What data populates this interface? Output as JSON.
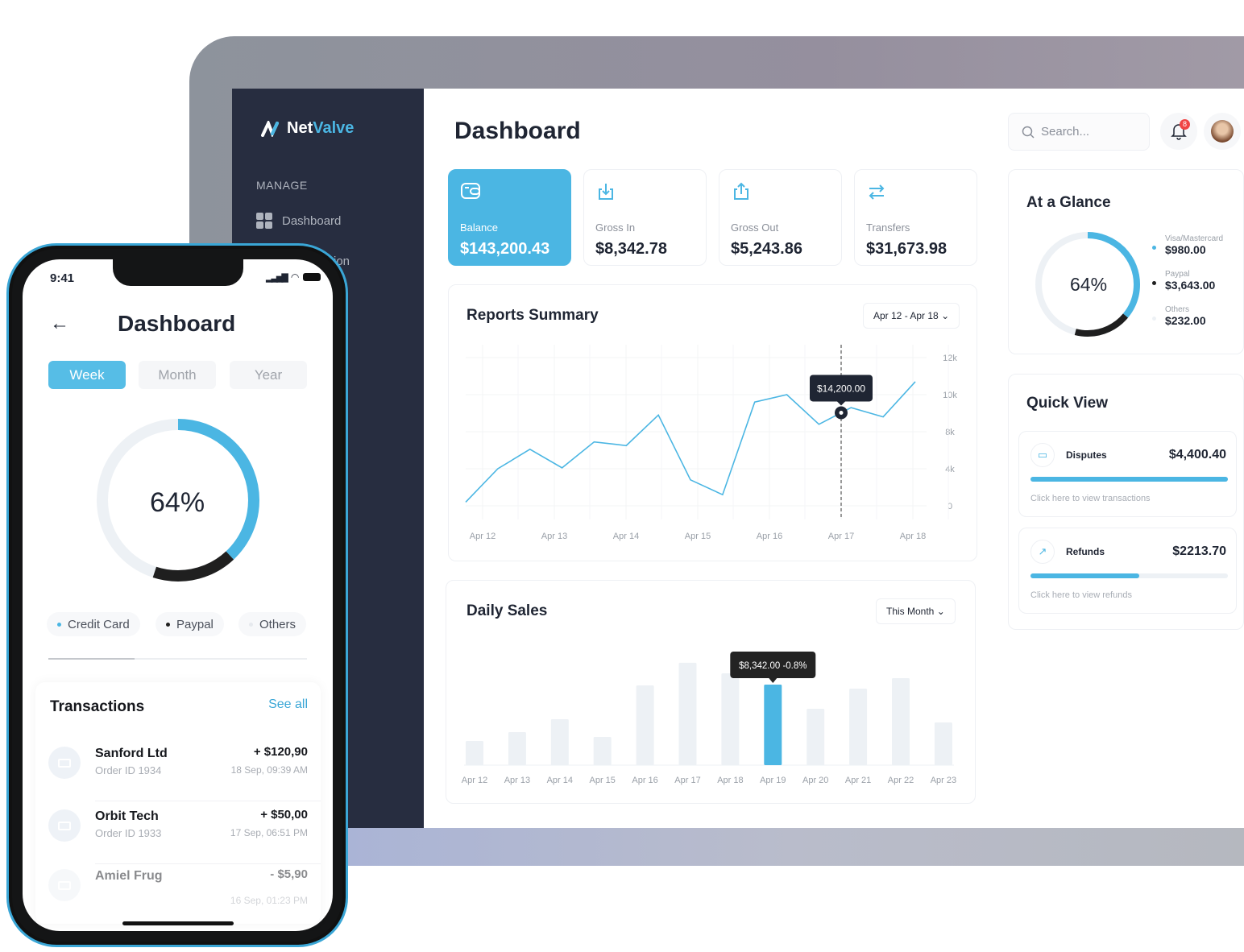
{
  "brand": {
    "name_part1": "Net",
    "name_part2": "Valve"
  },
  "sidebar": {
    "section": "MANAGE",
    "items": [
      {
        "label": "Dashboard",
        "icon": "grid-icon"
      },
      {
        "label": "ion"
      }
    ]
  },
  "header": {
    "title": "Dashboard",
    "search_placeholder": "Search...",
    "notification_count": "8"
  },
  "stats": [
    {
      "label": "Balance",
      "value": "$143,200.43",
      "icon": "wallet-icon",
      "active": true
    },
    {
      "label": "Gross In",
      "value": "$8,342.78",
      "icon": "download-icon"
    },
    {
      "label": "Gross Out",
      "value": "$5,243.86",
      "icon": "upload-icon"
    },
    {
      "label": "Transfers",
      "value": "$31,673.98",
      "icon": "transfer-icon"
    }
  ],
  "reports": {
    "title": "Reports Summary",
    "range": "Apr 12 - Apr 18",
    "tooltip": "$14,200.00"
  },
  "daily": {
    "title": "Daily Sales",
    "range": "This Month",
    "tooltip": "$8,342.00  -0.8%"
  },
  "glance": {
    "title": "At a Glance",
    "percent": "64%",
    "legend": [
      {
        "label": "Visa/Mastercard",
        "value": "$980.00",
        "color": "#4bb6e3"
      },
      {
        "label": "Paypal",
        "value": "$3,643.00",
        "color": "#1f1f1f"
      },
      {
        "label": "Others",
        "value": "$232.00",
        "color": "#edf1f5"
      }
    ],
    "arcs": [
      0.36,
      0.18
    ]
  },
  "quick_view": {
    "title": "Quick View",
    "items": [
      {
        "label": "Disputes",
        "value": "$4,400.40",
        "hint": "Click here to view transactions",
        "progress": 1.0
      },
      {
        "label": "Refunds",
        "value": "$2213.70",
        "hint": "Click here to view refunds",
        "progress": 0.55
      }
    ]
  },
  "phone": {
    "time": "9:41",
    "title": "Dashboard",
    "tabs": [
      "Week",
      "Month",
      "Year"
    ],
    "active_tab": "Week",
    "percent": "64%",
    "arcs": [
      0.38,
      0.17
    ],
    "chips": [
      {
        "label": "Credit Card",
        "color": "#4bb6e3"
      },
      {
        "label": "Paypal",
        "color": "#1f1f1f"
      },
      {
        "label": "Others",
        "color": "#e6e9ee"
      }
    ],
    "transactions_title": "Transactions",
    "see_all": "See all",
    "transactions": [
      {
        "name": "Sanford Ltd",
        "order": "Order ID 1934",
        "amount": "+ $120,90",
        "date": "18 Sep, 09:39 AM"
      },
      {
        "name": "Orbit Tech",
        "order": "Order ID 1933",
        "amount": "+ $50,00",
        "date": "17 Sep, 06:51 PM"
      },
      {
        "name": "Amiel Frug",
        "order": "",
        "amount": "- $5,90",
        "date": "16 Sep, 01:23 PM"
      }
    ]
  },
  "chart_data": [
    {
      "type": "line",
      "title": "Reports Summary",
      "categories": [
        "Apr 12",
        "Apr 13",
        "Apr 14",
        "Apr 15",
        "Apr 16",
        "Apr 17",
        "Apr 18"
      ],
      "yticks": [
        "0",
        "4k",
        "8k",
        "10k",
        "12k"
      ],
      "ytick_values": [
        0,
        4000,
        8000,
        10000,
        12000
      ],
      "values": [
        400,
        4000,
        6100,
        4100,
        6900,
        6500,
        8900,
        2800,
        1200,
        9600,
        10000,
        8400,
        9300,
        8800,
        10700
      ],
      "color": "#4bb6e3",
      "highlight_label": "Apr 17",
      "grid": true
    },
    {
      "type": "bar",
      "title": "Daily Sales",
      "categories": [
        "Apr 12",
        "Apr 13",
        "Apr 14",
        "Apr 15",
        "Apr 16",
        "Apr 17",
        "Apr 18",
        "Apr 19",
        "Apr 20",
        "Apr 21",
        "Apr 22",
        "Apr 23"
      ],
      "values": [
        2500,
        3420,
        4750,
        2920,
        8260,
        10600,
        9510,
        8342,
        5840,
        7920,
        9010,
        4420
      ],
      "highlight": "Apr 19",
      "highlight_color": "#4bb6e3",
      "bar_color": "#edf1f5"
    }
  ]
}
